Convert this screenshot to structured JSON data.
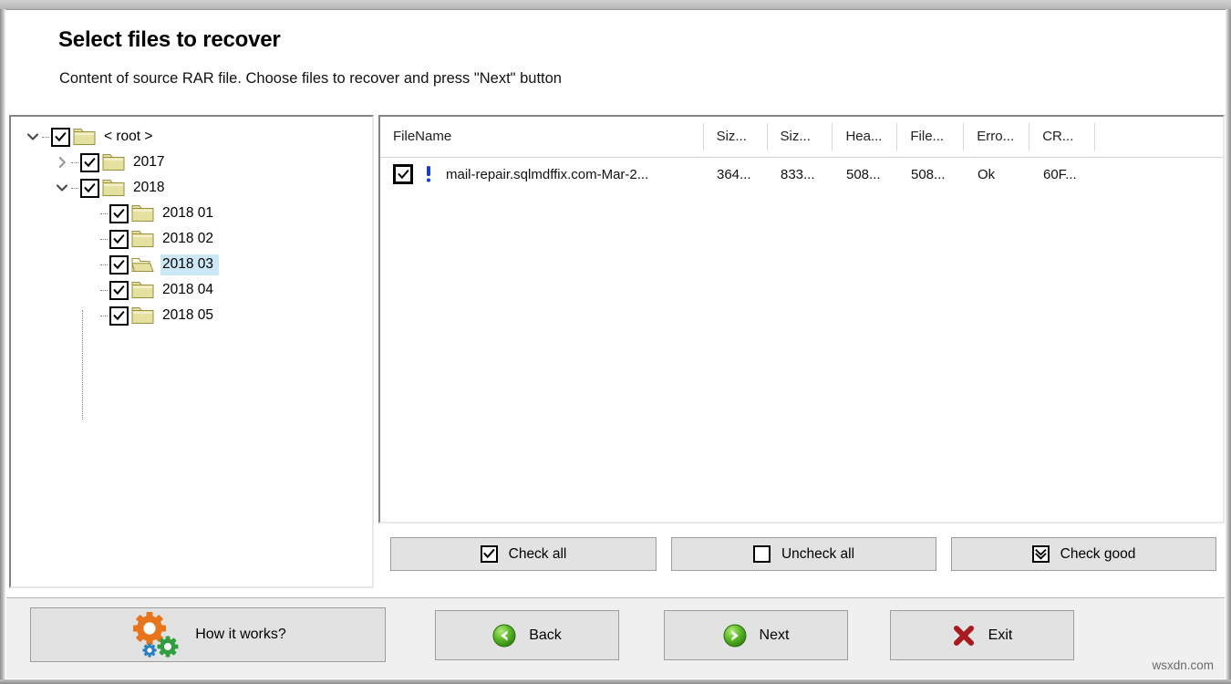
{
  "window": {
    "title": "Select files to recover"
  },
  "header": {
    "title": "Select files to recover",
    "subtitle": "Content of source RAR file. Choose files to recover and press \"Next\" button"
  },
  "tree": {
    "nodes": [
      {
        "label": "< root >",
        "depth": 0,
        "expander": "chevron-down-icon",
        "checked": true,
        "folder": "folder-closed-icon",
        "selected": false
      },
      {
        "label": "2017",
        "depth": 1,
        "expander": "chevron-right-icon",
        "checked": true,
        "folder": "folder-closed-icon",
        "selected": false
      },
      {
        "label": "2018",
        "depth": 1,
        "expander": "chevron-down-icon",
        "checked": true,
        "folder": "folder-closed-icon",
        "selected": false
      },
      {
        "label": "2018 01",
        "depth": 2,
        "expander": "none",
        "checked": true,
        "folder": "folder-closed-icon",
        "selected": false
      },
      {
        "label": "2018 02",
        "depth": 2,
        "expander": "none",
        "checked": true,
        "folder": "folder-closed-icon",
        "selected": false
      },
      {
        "label": "2018 03",
        "depth": 2,
        "expander": "none",
        "checked": true,
        "folder": "folder-open-icon",
        "selected": true
      },
      {
        "label": "2018 04",
        "depth": 2,
        "expander": "none",
        "checked": true,
        "folder": "folder-closed-icon",
        "selected": false
      },
      {
        "label": "2018 05",
        "depth": 2,
        "expander": "none",
        "checked": true,
        "folder": "folder-closed-icon",
        "selected": false
      }
    ]
  },
  "file_list": {
    "columns": [
      {
        "key": "name",
        "label": "FileName"
      },
      {
        "key": "size1",
        "label": "Siz..."
      },
      {
        "key": "size2",
        "label": "Siz..."
      },
      {
        "key": "head",
        "label": "Hea..."
      },
      {
        "key": "file",
        "label": "File..."
      },
      {
        "key": "error",
        "label": "Erro..."
      },
      {
        "key": "crc",
        "label": "CR..."
      }
    ],
    "rows": [
      {
        "checked": true,
        "status_icon": "exclamation-icon",
        "name": "mail-repair.sqlmdffix.com-Mar-2...",
        "size1": "364...",
        "size2": "833...",
        "head": "508...",
        "file": "508...",
        "error": "Ok",
        "crc": "60F..."
      }
    ]
  },
  "check_buttons": [
    {
      "id": "check-all",
      "label": "Check all",
      "icon": "checkbox-checked-icon"
    },
    {
      "id": "uncheck-all",
      "label": "Uncheck all",
      "icon": "checkbox-empty-icon"
    },
    {
      "id": "check-good",
      "label": "Check good",
      "icon": "checkbox-double-check-icon"
    }
  ],
  "actions": {
    "how_it_works": {
      "label": "How it works?",
      "icon": "gears-icon"
    },
    "back": {
      "label": "Back",
      "icon": "arrow-left-circle-icon"
    },
    "next": {
      "label": "Next",
      "icon": "arrow-right-circle-icon"
    },
    "exit": {
      "label": "Exit",
      "icon": "x-mark-icon"
    }
  },
  "watermark": "wsxdn.com",
  "colors": {
    "folder": "#e3e0a0",
    "folder_border": "#9a8f3c",
    "selection": "#cce8f7",
    "gear_orange": "#e8741c",
    "gear_green": "#2e9e3e",
    "gear_blue": "#2a7fc1",
    "arrow_green": "#4fb122",
    "exit_red": "#a81a20",
    "exclamation_blue": "#1a3fd0",
    "button_face": "#e2e2e2"
  }
}
